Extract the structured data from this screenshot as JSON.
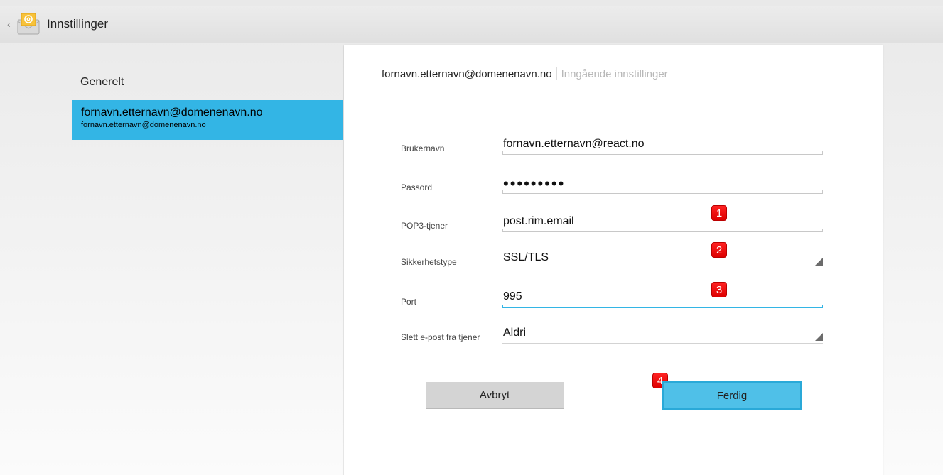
{
  "actionbar": {
    "title": "Innstillinger",
    "up_caret": "‹"
  },
  "sidebar": {
    "header": "Generelt",
    "account": {
      "display_name": "fornavn.etternavn@domenenavn.no",
      "email": "fornavn.etternavn@domenenavn.no"
    }
  },
  "breadcrumb": {
    "account": "fornavn.etternavn@domenenavn.no",
    "current": "Inngående innstillinger"
  },
  "form": {
    "username": {
      "label": "Brukernavn",
      "value": "fornavn.etternavn@react.no"
    },
    "password": {
      "label": "Passord",
      "value": "•••••••••"
    },
    "server": {
      "label": "POP3-tjener",
      "value": "post.rim.email"
    },
    "security": {
      "label": "Sikkerhetstype",
      "value": "SSL/TLS"
    },
    "port": {
      "label": "Port",
      "value": "995"
    },
    "delete": {
      "label": "Slett e-post fra tjener",
      "value": "Aldri"
    }
  },
  "badges": [
    "1",
    "2",
    "3",
    "4"
  ],
  "buttons": {
    "cancel": "Avbryt",
    "done": "Ferdig"
  },
  "colors": {
    "accent": "#33b5e5",
    "badge": "#e00000"
  }
}
